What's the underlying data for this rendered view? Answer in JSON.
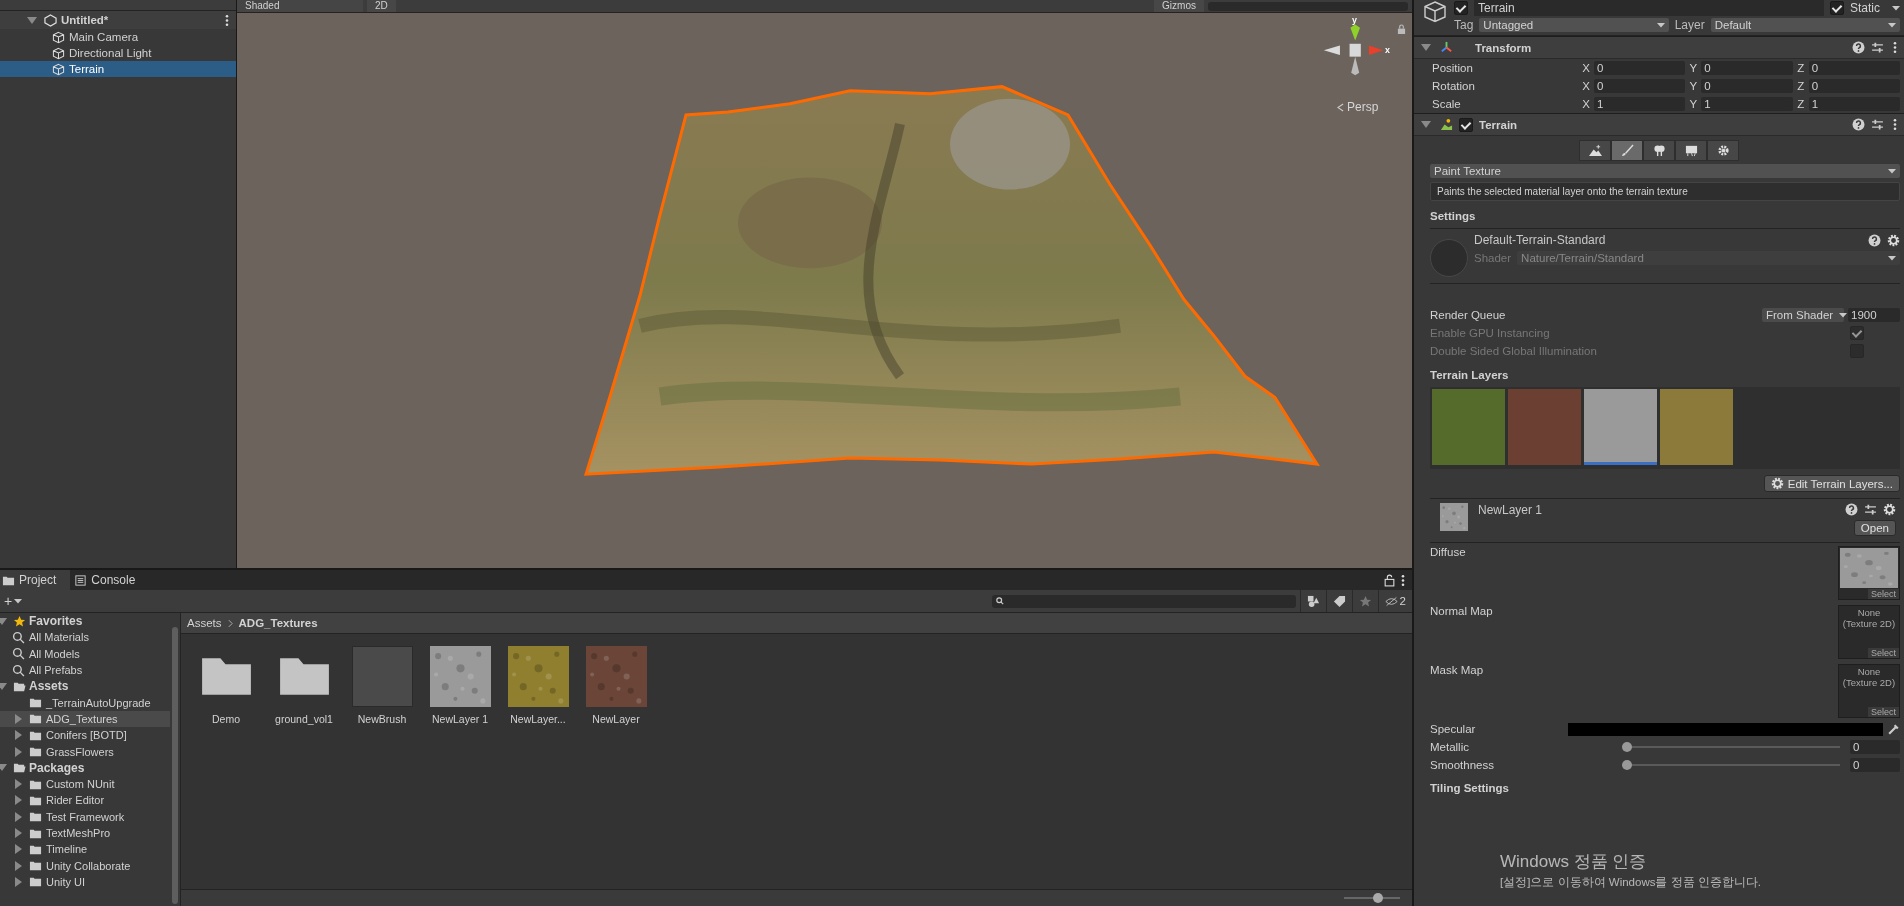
{
  "hierarchy": {
    "scene": "Untitled*",
    "items": [
      {
        "name": "Main Camera",
        "selected": false
      },
      {
        "name": "Directional Light",
        "selected": false
      },
      {
        "name": "Terrain",
        "selected": true
      }
    ]
  },
  "scene_view": {
    "toolbar": {
      "draw_mode": "Shaded",
      "mode_2d": "2D",
      "gizmos": "Gizmos"
    },
    "gizmo": {
      "y_label": "y",
      "x_label": "x",
      "projection": "Persp"
    }
  },
  "inspector": {
    "object": {
      "active": true,
      "name": "Terrain",
      "static": true,
      "static_label": "Static",
      "tag_label": "Tag",
      "tag": "Untagged",
      "layer_label": "Layer",
      "layer": "Default"
    },
    "transform": {
      "title": "Transform",
      "expanded": true,
      "rows": [
        {
          "label": "Position",
          "fields": [
            {
              "axis": "X",
              "value": "0"
            },
            {
              "axis": "Y",
              "value": "0"
            },
            {
              "axis": "Z",
              "value": "0"
            }
          ]
        },
        {
          "label": "Rotation",
          "fields": [
            {
              "axis": "X",
              "value": "0"
            },
            {
              "axis": "Y",
              "value": "0"
            },
            {
              "axis": "Z",
              "value": "0"
            }
          ]
        },
        {
          "label": "Scale",
          "fields": [
            {
              "axis": "X",
              "value": "1"
            },
            {
              "axis": "Y",
              "value": "1"
            },
            {
              "axis": "Z",
              "value": "1"
            }
          ]
        }
      ]
    },
    "terrain": {
      "title": "Terrain",
      "expanded": true,
      "enabled": true,
      "tools": [
        {
          "kind": "raise",
          "selected": false
        },
        {
          "kind": "paint",
          "selected": true
        },
        {
          "kind": "trees",
          "selected": false
        },
        {
          "kind": "details",
          "selected": false
        },
        {
          "kind": "settings",
          "selected": false
        }
      ],
      "mode": "Paint Texture",
      "description": "Paints the selected material layer onto the terrain texture",
      "settings_title": "Settings",
      "material": {
        "name": "Default-Terrain-Standard",
        "shader_label": "Shader",
        "shader": "Nature/Terrain/Standard"
      },
      "render_queue": {
        "label": "Render Queue",
        "mode": "From Shader",
        "value": "1900"
      },
      "options": [
        {
          "label": "Enable GPU Instancing",
          "checked": true,
          "disabled": true
        },
        {
          "label": "Double Sided Global Illumination",
          "checked": false,
          "disabled": true
        }
      ],
      "layers_title": "Terrain Layers",
      "layers": [
        {
          "color": "#546b2c",
          "selected": false
        },
        {
          "color": "#6b3f32",
          "selected": false
        },
        {
          "color": "#9a9a9a",
          "selected": true
        },
        {
          "color": "#8c7a3a",
          "selected": false
        }
      ],
      "edit_layers": "Edit Terrain Layers..."
    },
    "layer": {
      "name": "NewLayer 1",
      "open": "Open",
      "maps": [
        {
          "label": "Diffuse",
          "kind": "texture",
          "select": "Select"
        },
        {
          "label": "Normal Map",
          "kind": "empty",
          "empty_text": "None (Texture 2D)",
          "select": "Select"
        },
        {
          "label": "Mask Map",
          "kind": "empty",
          "empty_text": "None (Texture 2D)",
          "select": "Select"
        }
      ],
      "specular": {
        "label": "Specular",
        "color": "#000000"
      },
      "sliders": [
        {
          "label": "Metallic",
          "level": 0,
          "reading": "0"
        },
        {
          "label": "Smoothness",
          "level": 0,
          "reading": "0"
        }
      ],
      "tiling_title": "Tiling Settings"
    }
  },
  "project": {
    "tabs": [
      {
        "label": "Project",
        "selected": true
      },
      {
        "label": "Console",
        "selected": false
      }
    ],
    "add_label": "+",
    "hidden_count": "2",
    "tree": [
      {
        "label": "Favorites",
        "kind": "favorites",
        "expanded": true,
        "children": [
          {
            "label": "All Materials",
            "kind": "search",
            "selected": false
          },
          {
            "label": "All Models",
            "kind": "search",
            "selected": false
          },
          {
            "label": "All Prefabs",
            "kind": "search",
            "selected": false
          }
        ]
      },
      {
        "label": "Assets",
        "kind": "folder",
        "expanded": true,
        "children": [
          {
            "label": "_TerrainAutoUpgrade",
            "kind": "leaf",
            "selected": false
          },
          {
            "label": "ADG_Textures",
            "kind": "folder",
            "selected": true
          },
          {
            "label": "Conifers [BOTD]",
            "kind": "folder",
            "selected": false
          },
          {
            "label": "GrassFlowers",
            "kind": "folder",
            "selected": false
          }
        ]
      },
      {
        "label": "Packages",
        "kind": "folder",
        "expanded": true,
        "children": [
          {
            "label": "Custom NUnit",
            "kind": "folder",
            "selected": false
          },
          {
            "label": "Rider Editor",
            "kind": "folder",
            "selected": false
          },
          {
            "label": "Test Framework",
            "kind": "folder",
            "selected": false
          },
          {
            "label": "TextMeshPro",
            "kind": "folder",
            "selected": false
          },
          {
            "label": "Timeline",
            "kind": "folder",
            "selected": false
          },
          {
            "label": "Unity Collaborate",
            "kind": "folder",
            "selected": false
          },
          {
            "label": "Unity UI",
            "kind": "folder",
            "selected": false
          }
        ]
      }
    ],
    "breadcrumb": [
      "Assets",
      "ADG_Textures"
    ],
    "assets": [
      {
        "name": "Demo",
        "kind": "folder"
      },
      {
        "name": "ground_vol1",
        "kind": "folder"
      },
      {
        "name": "NewBrush",
        "kind": "brush",
        "color": "#4a4a4a"
      },
      {
        "name": "NewLayer 1",
        "kind": "texture",
        "color": "#9a9a9a"
      },
      {
        "name": "NewLayer...",
        "kind": "texture",
        "color": "#8f7f2e"
      },
      {
        "name": "NewLayer",
        "kind": "texture",
        "color": "#6a4538"
      }
    ],
    "zoom": {
      "level": 0.6
    }
  },
  "os_notice": {
    "title": "Windows 정품 인증",
    "message": "[설정]으로 이동하여 Windows를 정품 인증합니다."
  }
}
